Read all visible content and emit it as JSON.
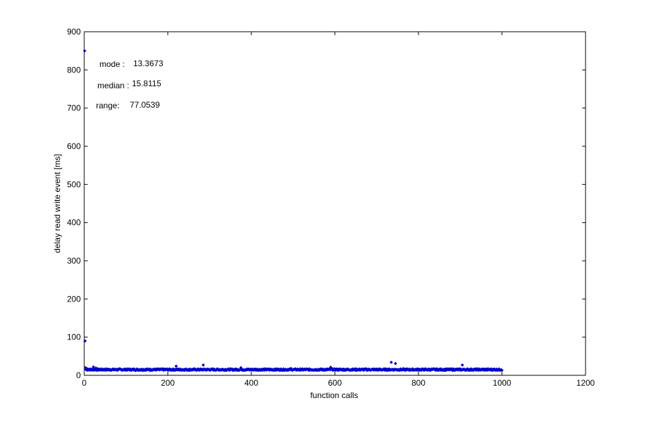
{
  "chart_data": {
    "type": "scatter",
    "title": "",
    "xlabel": "function calls",
    "ylabel": "delay read write event [ms]",
    "xlim": [
      0,
      1200
    ],
    "ylim": [
      0,
      900
    ],
    "xticks": [
      0,
      200,
      400,
      600,
      800,
      1000,
      1200
    ],
    "yticks": [
      0,
      100,
      200,
      300,
      400,
      500,
      600,
      700,
      800,
      900
    ],
    "grid": false,
    "legend": "none",
    "marker_color": "#0000cc",
    "n_points": 1000,
    "baseline_value": 15,
    "outliers": [
      {
        "x": 1,
        "y": 850
      },
      {
        "x": 2,
        "y": 90
      },
      {
        "x": 3,
        "y": 20
      },
      {
        "x": 5,
        "y": 18
      },
      {
        "x": 8,
        "y": 17
      },
      {
        "x": 12,
        "y": 16
      },
      {
        "x": 22,
        "y": 22
      },
      {
        "x": 28,
        "y": 19
      },
      {
        "x": 220,
        "y": 24
      },
      {
        "x": 285,
        "y": 27
      },
      {
        "x": 375,
        "y": 20
      },
      {
        "x": 495,
        "y": 18
      },
      {
        "x": 590,
        "y": 21
      },
      {
        "x": 735,
        "y": 34
      },
      {
        "x": 745,
        "y": 31
      },
      {
        "x": 905,
        "y": 27
      }
    ],
    "annotations": [
      {
        "label": "mode :",
        "value": "13.3673"
      },
      {
        "label": "median :",
        "value": "15.8115"
      },
      {
        "label": "range:",
        "value": "77.0539"
      }
    ]
  }
}
